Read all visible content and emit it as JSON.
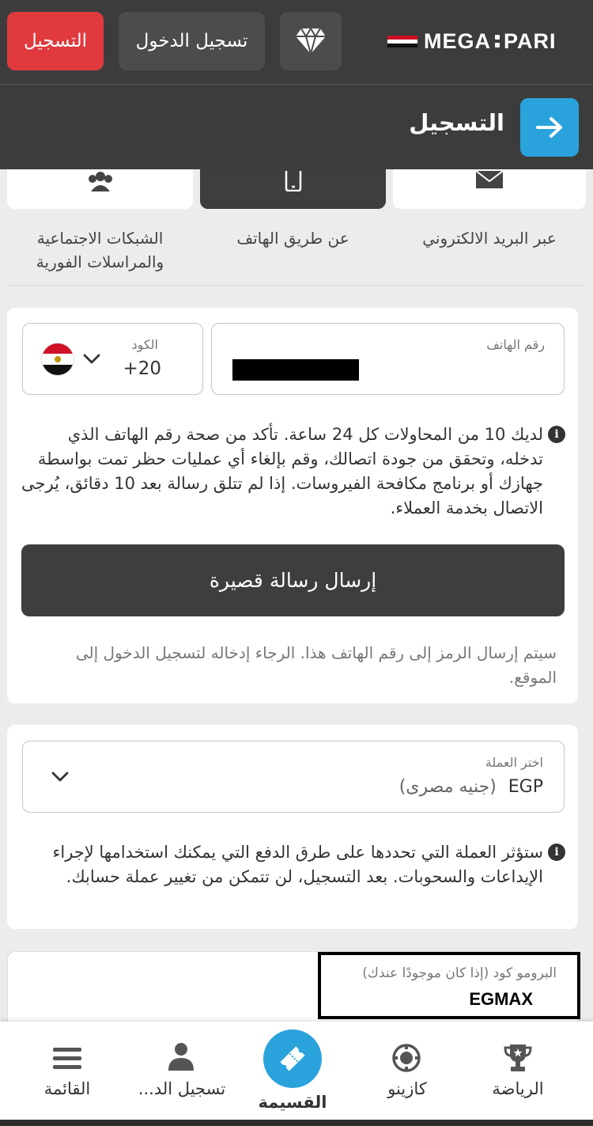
{
  "header": {
    "register_label": "التسجيل",
    "login_label": "تسجيل الدخول",
    "logo_left": "MEGA",
    "logo_right": "PARI",
    "colors": {
      "register": "#e03a3e",
      "accent": "#2aa3dd",
      "dark": "#3c3c3c"
    }
  },
  "subheader": {
    "title": "التسجيل",
    "back_icon": "arrow-right-icon"
  },
  "tabs": [
    {
      "label_line1": "الشبكات الاجتماعية",
      "label_line2": "والمراسلات الفورية",
      "icon": "users-icon"
    },
    {
      "label": "عن طريق الهاتف",
      "icon": "phone-icon"
    },
    {
      "label": "عبر البريد الالكتروني",
      "icon": "envelope-icon"
    }
  ],
  "phone_form": {
    "phone_label": "رقم الهاتف",
    "code_label": "الكود",
    "code_value": "+20",
    "info": "لديك 10 من المحاولات كل 24 ساعة. تأكد من صحة رقم الهاتف الذي تدخله، وتحقق من جودة اتصالك، وقم بإلغاء أي عمليات حظر تمت بواسطة جهازك أو برنامج مكافحة الفيروسات. إذا لم تتلق رسالة بعد 10 دقائق، يُرجى الاتصال بخدمة العملاء.",
    "send_button": "إرسال رسالة قصيرة",
    "note": "سيتم إرسال الرمز إلى رقم الهاتف هذا. الرجاء إدخاله لتسجيل الدخول إلى الموقع."
  },
  "currency": {
    "label": "اختر العملة",
    "code": "EGP",
    "name": "(جنيه مصرى)",
    "info": "ستؤثر العملة التي تحددها على طرق الدفع التي يمكنك استخدامها لإجراء الإيداعات والسحوبات. بعد التسجيل، لن تتمكن من تغيير عملة حسابك."
  },
  "promo": {
    "label": "البرومو كود (إذا كان موجودًا عندك)",
    "value": "EGMAX"
  },
  "bottom_nav": {
    "menu": "القائمة",
    "login": "تسجيل الد...",
    "coupon": "القسيمة",
    "casino": "كازينو",
    "sports": "الرياضة"
  }
}
